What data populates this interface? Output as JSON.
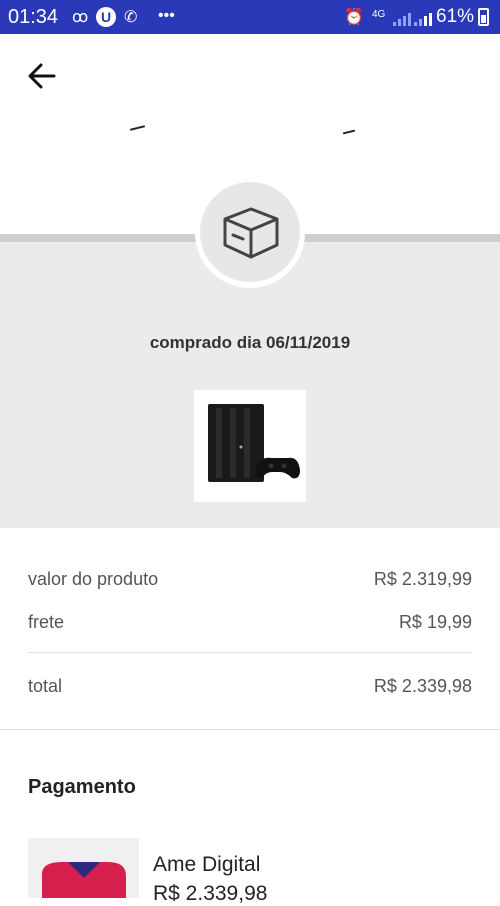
{
  "status_bar": {
    "time": "01:34",
    "network": "4G",
    "battery": "61%"
  },
  "order": {
    "purchase_date": "comprado dia 06/11/2019"
  },
  "summary": {
    "product_label": "valor do produto",
    "product_value": "R$ 2.319,99",
    "shipping_label": "frete",
    "shipping_value": "R$ 19,99",
    "total_label": "total",
    "total_value": "R$ 2.339,98"
  },
  "payment": {
    "title": "Pagamento",
    "method": "Ame Digital",
    "amount": "R$ 2.339,98"
  },
  "colors": {
    "status_bar": "#2a39b8",
    "band": "#ebebeb",
    "card_red": "#d61f4d"
  },
  "icons": {
    "back": "arrow-left-icon",
    "box": "box-icon"
  }
}
